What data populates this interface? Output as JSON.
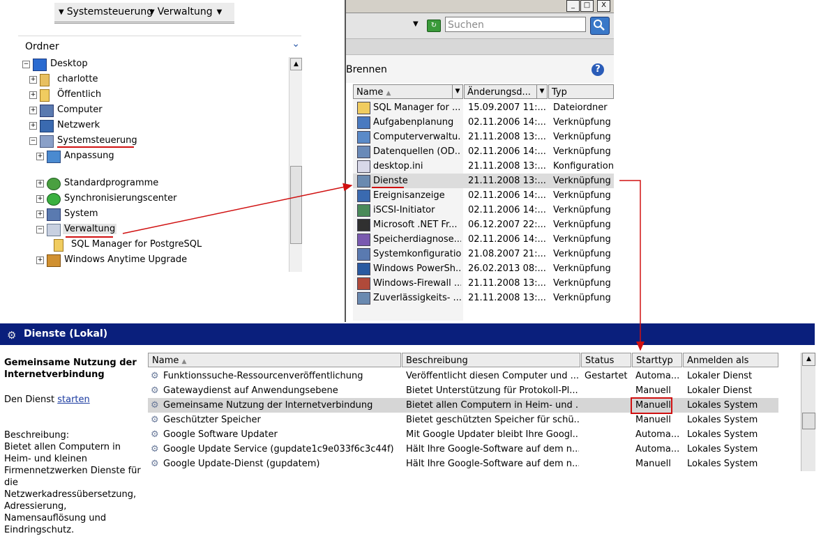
{
  "breadcrumb": {
    "items": [
      "Systemsteuerung",
      "Verwaltung"
    ]
  },
  "tree": {
    "header": "Ordner",
    "items": [
      {
        "label": "Desktop",
        "expander": "−"
      },
      {
        "label": "charlotte",
        "expander": "+"
      },
      {
        "label": "Öffentlich",
        "expander": "+"
      },
      {
        "label": "Computer",
        "expander": "+"
      },
      {
        "label": "Netzwerk",
        "expander": "+"
      },
      {
        "label": "Systemsteuerung",
        "expander": "−"
      },
      {
        "label": "Anpassung",
        "expander": "+"
      },
      {
        "label": "Standardprogramme",
        "expander": "+"
      },
      {
        "label": "Synchronisierungscenter",
        "expander": "+"
      },
      {
        "label": "System",
        "expander": "+"
      },
      {
        "label": "Verwaltung",
        "expander": "−"
      },
      {
        "label": "SQL Manager for PostgreSQL",
        "expander": ""
      },
      {
        "label": "Windows Anytime Upgrade",
        "expander": "+"
      }
    ]
  },
  "explorer": {
    "window_buttons": [
      "_",
      "□",
      "X"
    ],
    "search_placeholder": "Suchen",
    "toolbar_label": "Brennen",
    "help_label": "?",
    "columns": [
      "Name",
      "Änderungsd...",
      "Typ"
    ],
    "files": [
      {
        "name": "SQL Manager for ...",
        "date": "15.09.2007 11:...",
        "type": "Dateiordner"
      },
      {
        "name": "Aufgabenplanung",
        "date": "02.11.2006 14:...",
        "type": "Verknüpfung"
      },
      {
        "name": "Computerverwaltu...",
        "date": "21.11.2008 13:...",
        "type": "Verknüpfung"
      },
      {
        "name": "Datenquellen (OD...",
        "date": "02.11.2006 14:...",
        "type": "Verknüpfung"
      },
      {
        "name": "desktop.ini",
        "date": "21.11.2008 13:...",
        "type": "Konfigurations"
      },
      {
        "name": "Dienste",
        "date": "21.11.2008 13:...",
        "type": "Verknüpfung"
      },
      {
        "name": "Ereignisanzeige",
        "date": "02.11.2006 14:...",
        "type": "Verknüpfung"
      },
      {
        "name": "iSCSI-Initiator",
        "date": "02.11.2006 14:...",
        "type": "Verknüpfung"
      },
      {
        "name": "Microsoft .NET Fr...",
        "date": "06.12.2007 22:...",
        "type": "Verknüpfung"
      },
      {
        "name": "Speicherdiagnose...",
        "date": "02.11.2006 14:...",
        "type": "Verknüpfung"
      },
      {
        "name": "Systemkonfiguration",
        "date": "21.08.2007 21:...",
        "type": "Verknüpfung"
      },
      {
        "name": "Windows PowerSh...",
        "date": "26.02.2013 08:...",
        "type": "Verknüpfung"
      },
      {
        "name": "Windows-Firewall ...",
        "date": "21.11.2008 13:...",
        "type": "Verknüpfung"
      },
      {
        "name": "Zuverlässigkeits- ...",
        "date": "21.11.2008 13:...",
        "type": "Verknüpfung"
      }
    ]
  },
  "services": {
    "title": "Dienste (Lokal)",
    "selected_heading": "Gemeinsame Nutzung der Internetverbindung",
    "start_prefix": "Den Dienst ",
    "start_link": "starten",
    "desc_label": "Beschreibung:",
    "desc_text": "Bietet allen Computern in Heim- und kleinen Firmennetzwerken Dienste für die Netzwerkadressübersetzung, Adressierung, Namensauflösung und Eindringschutz.",
    "columns": [
      "Name",
      "Beschreibung",
      "Status",
      "Starttyp",
      "Anmelden als"
    ],
    "rows": [
      {
        "name": "Funktionssuche-Ressourcenveröffentlichung",
        "desc": "Veröffentlicht diesen Computer und ...",
        "status": "Gestartet",
        "start": "Automa...",
        "logon": "Lokaler Dienst"
      },
      {
        "name": "Gatewaydienst auf Anwendungsebene",
        "desc": "Bietet Unterstützung für Protokoll-Pl...",
        "status": "",
        "start": "Manuell",
        "logon": "Lokaler Dienst"
      },
      {
        "name": "Gemeinsame Nutzung der Internetverbindung",
        "desc": "Bietet allen Computern in Heim- und ...",
        "status": "",
        "start": "Manuell",
        "logon": "Lokales System"
      },
      {
        "name": "Geschützter Speicher",
        "desc": "Bietet geschützten Speicher für schü...",
        "status": "",
        "start": "Manuell",
        "logon": "Lokales System"
      },
      {
        "name": "Google Software Updater",
        "desc": "Mit Google Updater bleibt Ihre Googl...",
        "status": "",
        "start": "Automa...",
        "logon": "Lokales System"
      },
      {
        "name": "Google Update Service (gupdate1c9e033f6c3c44f)",
        "desc": "Hält Ihre Google-Software auf dem n...",
        "status": "",
        "start": "Automa...",
        "logon": "Lokales System"
      },
      {
        "name": "Google Update-Dienst (gupdatem)",
        "desc": "Hält Ihre Google-Software auf dem n...",
        "status": "",
        "start": "Manuell",
        "logon": "Lokales System"
      }
    ]
  },
  "colors": {
    "highlight_red": "#d01010",
    "services_titlebar": "#0a1f7c"
  }
}
